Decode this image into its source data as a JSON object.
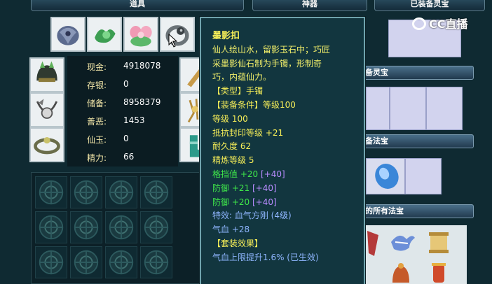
{
  "tabs": {
    "items": "道具",
    "artifact": "神器",
    "equipped_lingbao": "已装备灵宝"
  },
  "logo": {
    "text": "CC直播"
  },
  "stats": [
    {
      "label": "现金:",
      "value": "4918078"
    },
    {
      "label": "存银:",
      "value": "0"
    },
    {
      "label": "储备:",
      "value": "8958379"
    },
    {
      "label": "善恶:",
      "value": "1453"
    },
    {
      "label": "仙玉:",
      "value": "0"
    },
    {
      "label": "精力:",
      "value": "66"
    }
  ],
  "sections": {
    "equip_lingbao": "备灵宝",
    "equip_fabao": "备法宝",
    "all_fabao": "的所有法宝"
  },
  "tooltip": {
    "name": "墨影扣",
    "desc": [
      "仙人绘山水，留影玉石中；巧匠",
      "采墨影仙石制为手镯，形制奇",
      "巧，内蕴仙力。"
    ],
    "type": "【类型】手镯",
    "requirement": "【装备条件】等级100",
    "level": "等级 100",
    "seal_resist": "抵抗封印等级 +21",
    "durability": "耐久度 62",
    "refine": "精炼等级 5",
    "block": "格挡值 +20",
    "block_bonus": "[+40]",
    "defense1": "防御 +21",
    "defense1_bonus": "[+40]",
    "defense2": "防御 +20",
    "defense2_bonus": "[+40]",
    "special": "特效: 血气方刚 (4级)",
    "hp": "气血 +28",
    "set_effect": "【套装效果】",
    "set_line": "气血上限提升1.6% (已生效)"
  },
  "icons": {
    "top_items": [
      "armor-icon",
      "jade-pendant-icon",
      "lotus-icon",
      "silver-ring-icon"
    ],
    "equip_left": [
      "helmet-icon",
      "necklace-icon",
      "bracelet-icon"
    ],
    "equip_right": [
      "weapon-icon",
      "gem-icon",
      "boots-icon"
    ],
    "fabao": "blue-orb-icon",
    "all_fabao": [
      "talisman-icon",
      "bird-icon",
      "scroll-icon",
      "bell-icon",
      "lantern-icon"
    ],
    "grid": "empty-slot-icon"
  },
  "colors": {
    "background": "#0f2a32",
    "tooltip_bg": "#12363f",
    "title_yellow": "#f6ee58",
    "stat_green": "#3fe64a",
    "bonus_purple": "#b98cff",
    "special_blue": "#8fb6ff",
    "lingbao_slot": "#d2d3ee"
  }
}
